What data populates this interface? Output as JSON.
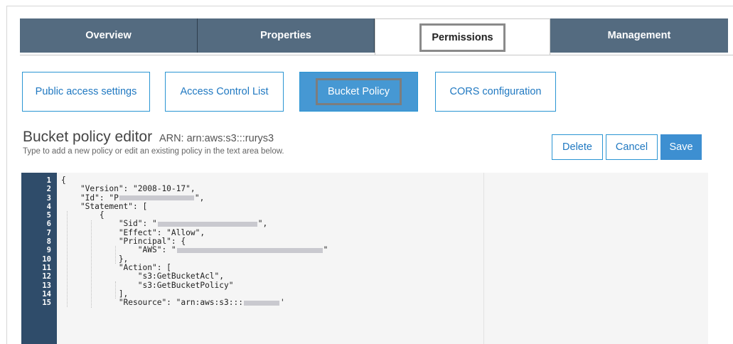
{
  "tabs": [
    {
      "label": "Overview"
    },
    {
      "label": "Properties"
    },
    {
      "label": "Permissions"
    },
    {
      "label": "Management"
    }
  ],
  "subtabs": [
    {
      "label": "Public access settings"
    },
    {
      "label": "Access Control List"
    },
    {
      "label": "Bucket Policy"
    },
    {
      "label": "CORS configuration"
    }
  ],
  "editor": {
    "title": "Bucket policy editor",
    "arn": "ARN: arn:aws:s3:::rurys3",
    "subtitle": "Type to add a new policy or edit an existing policy in the text area below."
  },
  "actions": {
    "delete_label": "Delete",
    "cancel_label": "Cancel",
    "save_label": "Save"
  },
  "code": {
    "line_numbers": [
      "1",
      "2",
      "3",
      "4",
      "5",
      "6",
      "7",
      "8",
      "9",
      "10",
      "11",
      "12",
      "13",
      "14",
      "15"
    ],
    "lines": [
      "{",
      "    \"Version\": \"2008-10-17\",",
      "    \"Id\": \"P",
      "    \"Statement\": [",
      "        {",
      "            \"Sid\": \"",
      "            \"Effect\": \"Allow\",",
      "            \"Principal\": {",
      "                \"AWS\": \"",
      "            },",
      "            \"Action\": [",
      "                \"s3:GetBucketAcl\",",
      "                \"s3:GetBucketPolicy\"",
      "            ],",
      "            \"Resource\": \"arn:aws:s3:::"
    ],
    "line_tails": [
      "",
      "",
      "\",",
      "",
      "",
      "\",",
      "",
      "",
      "\"",
      "",
      "",
      "",
      "",
      "",
      "'"
    ]
  }
}
